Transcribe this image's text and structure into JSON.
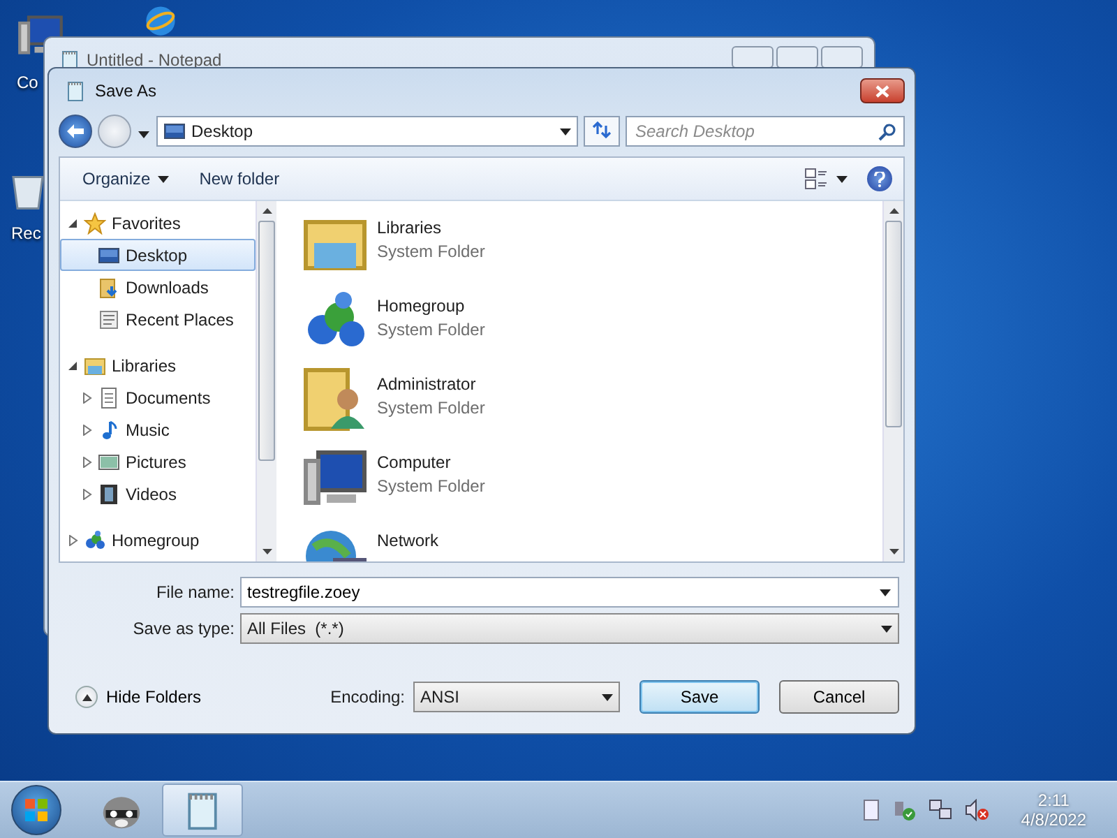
{
  "desktop": {
    "icons": [
      {
        "kind": "computer",
        "label": "Co"
      },
      {
        "kind": "browser"
      },
      {
        "kind": "recycle",
        "label": "Rec"
      }
    ]
  },
  "background_window": {
    "title": "Untitled - Notepad"
  },
  "dialog": {
    "title": "Save As",
    "address": "Desktop",
    "search": {
      "placeholder": "Search Desktop"
    },
    "toolbar": {
      "organize": "Organize",
      "new_folder": "New folder"
    },
    "nav": [
      {
        "kind": "favorites",
        "label": "Favorites",
        "expanded": true,
        "selected": false,
        "children": [
          {
            "kind": "desktop",
            "label": "Desktop",
            "selected": true
          },
          {
            "kind": "downloads",
            "label": "Downloads",
            "selected": false
          },
          {
            "kind": "recent",
            "label": "Recent Places",
            "selected": false
          }
        ]
      },
      {
        "kind": "libraries",
        "label": "Libraries",
        "expanded": true,
        "selected": false,
        "children": [
          {
            "kind": "documents",
            "label": "Documents",
            "expanded": false,
            "selected": false
          },
          {
            "kind": "music",
            "label": "Music",
            "expanded": false,
            "selected": false
          },
          {
            "kind": "pictures",
            "label": "Pictures",
            "expanded": false,
            "selected": false
          },
          {
            "kind": "videos",
            "label": "Videos",
            "expanded": false,
            "selected": false
          }
        ]
      },
      {
        "kind": "homegroup",
        "label": "Homegroup",
        "expanded": false,
        "selected": false
      }
    ],
    "items": [
      {
        "kind": "libraries",
        "name": "Libraries",
        "type": "System Folder"
      },
      {
        "kind": "homegroup",
        "name": "Homegroup",
        "type": "System Folder"
      },
      {
        "kind": "user",
        "name": "Administrator",
        "type": "System Folder"
      },
      {
        "kind": "computer",
        "name": "Computer",
        "type": "System Folder"
      },
      {
        "kind": "network",
        "name": "Network"
      }
    ],
    "file_name": {
      "label": "File name:",
      "value": "testregfile.zoey"
    },
    "save_as_type": {
      "label": "Save as type:",
      "value": "All Files  (*.*)"
    },
    "hide_folders": "Hide Folders",
    "encoding": {
      "label": "Encoding:",
      "value": "ANSI"
    },
    "buttons": [
      {
        "kind": "default",
        "label": "Save"
      },
      {
        "kind": "normal",
        "label": "Cancel"
      }
    ]
  },
  "taskbar": {
    "apps": [
      {
        "kind": "raccoon",
        "selected": false
      },
      {
        "kind": "notepad",
        "selected": true
      }
    ],
    "time": "2:11",
    "date": "4/8/2022"
  }
}
